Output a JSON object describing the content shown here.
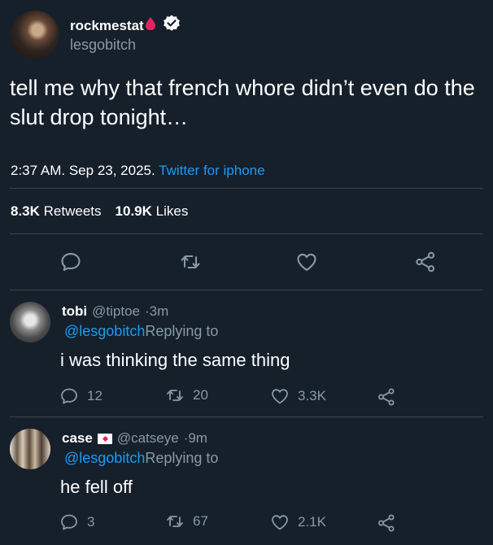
{
  "tweet": {
    "display_name": "rockmestat",
    "handle": "lesgobitch",
    "text": "tell me why that french whore didn’t even do the slut drop tonight…",
    "time": "2:37 AM",
    "date": "Sep 23, 2025",
    "sep1": ".",
    "sep2": ".",
    "source": "Twitter for iphone",
    "retweets_count": "8.3K",
    "retweets_label": "Retweets",
    "likes_count": "10.9K",
    "likes_label": "Likes"
  },
  "icons": {
    "reply": "reply-icon",
    "retweet": "retweet-icon",
    "like": "heart-icon",
    "share": "share-icon",
    "verified": "verified-badge-icon",
    "drop": "blood-drop-icon"
  },
  "colors": {
    "background": "#15202b",
    "secondary_text": "#8899a6",
    "link": "#1d9bf0",
    "divider": "#38444d",
    "drop": "#e0245e"
  },
  "replies": [
    {
      "name": "tobi",
      "handle": "@tiptoe",
      "time": "·3m",
      "mention": "@lesgobitch",
      "replying_to": "Replying to",
      "text": "i was thinking the same thing",
      "reply_count": "12",
      "retweet_count": "20",
      "like_count": "3.3K"
    },
    {
      "name": "case",
      "handle": "@catseye",
      "time": "·9m",
      "mention": "@lesgobitch",
      "replying_to": "Replying to",
      "text": "he fell off",
      "reply_count": "3",
      "retweet_count": "67",
      "like_count": "2.1K"
    }
  ]
}
